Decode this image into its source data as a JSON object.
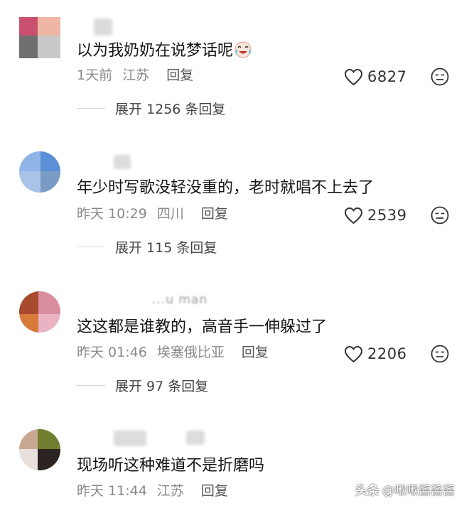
{
  "comments": [
    {
      "username_hint": "",
      "text": "以为我奶奶在说梦话呢",
      "emoji": "crying-laughing-face",
      "time": "1天前",
      "location": "江苏",
      "reply_label": "回复",
      "likes": "6827",
      "expand_label": "展开 1256 条回复",
      "avatar_colors": [
        "#c9506f",
        "#efb6a6",
        "#6f6f6f",
        "#c9c9c9"
      ]
    },
    {
      "username_hint": "",
      "text": "年少时写歌没轻没重的，老时就唱不上去了",
      "emoji": "",
      "time": "昨天 10:29",
      "location": "四川",
      "reply_label": "回复",
      "likes": "2539",
      "expand_label": "展开 115 条回复",
      "avatar_colors": [
        "#8fb4e6",
        "#5b8fd8",
        "#a9c2e8",
        "#7a9cc4"
      ]
    },
    {
      "username_hint": "...u man",
      "text": "这这都是谁教的，高音手一伸躲过了",
      "emoji": "",
      "time": "昨天 01:46",
      "location": "埃塞俄比亚",
      "reply_label": "回复",
      "likes": "2206",
      "expand_label": "展开 97 条回复",
      "avatar_colors": [
        "#a84a2e",
        "#d98ea0",
        "#d77a3a",
        "#e9b3c4"
      ]
    },
    {
      "username_hint": "",
      "text": "现场听这种难道不是折磨吗",
      "emoji": "",
      "time": "昨天 11:44",
      "location": "江苏",
      "reply_label": "回复",
      "likes": "",
      "expand_label": "",
      "avatar_colors": [
        "#c9a892",
        "#6f7e2f",
        "#e8e0dc",
        "#2a2320"
      ]
    }
  ],
  "watermark": {
    "logo": "头条",
    "handle": "@啾啾酱酱酱"
  },
  "icons": {
    "like": "heart-outline-icon",
    "dislike": "meh-face-icon"
  }
}
